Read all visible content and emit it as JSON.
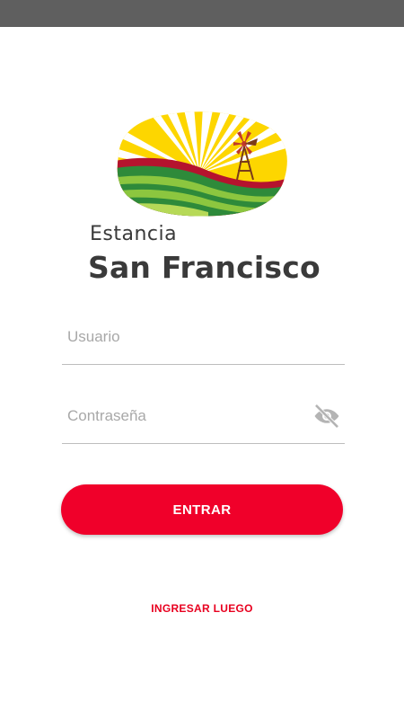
{
  "brand": {
    "line1": "Estancia",
    "line2": "San Francisco"
  },
  "login": {
    "username_placeholder": "Usuario",
    "username_value": "",
    "password_placeholder": "Contraseña",
    "password_value": "",
    "submit_label": "ENTRAR",
    "skip_label": "INGRESAR LUEGO"
  },
  "colors": {
    "accent": "#f0002a",
    "status_bar": "#5f5f5f",
    "text_dark": "#3a3a3a"
  },
  "icons": {
    "password_toggle": "eye-off-icon",
    "logo": "windmill-logo"
  }
}
